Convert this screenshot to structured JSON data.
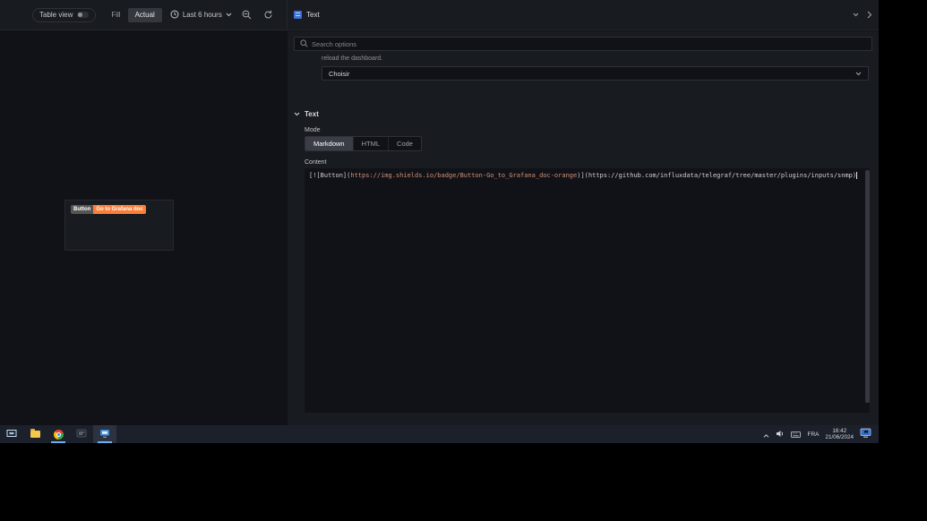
{
  "topbar": {
    "table_view_label": "Table view",
    "fill_label": "Fill",
    "actual_label": "Actual",
    "time_range_label": "Last 6 hours",
    "panel_type_label": "Text"
  },
  "preview": {
    "badge_left": "Button",
    "badge_right": "Go to Grafana doc"
  },
  "options": {
    "search_placeholder": "Search options",
    "description_text": "reload the dashboard.",
    "select_value": "Choisir",
    "section_title": "Text",
    "mode_label": "Mode",
    "mode_options": [
      "Markdown",
      "HTML",
      "Code"
    ],
    "mode_selected": "Markdown",
    "content_label": "Content",
    "code": {
      "seg1": "[![Button](",
      "url1": "https://img.shields.io/badge/Button-Go_to_Grafana_doc-orange",
      "seg2": ")](",
      "url2": "https://github.com/influxdata/telegraf/tree/master/plugins/inputs/snmp",
      "seg3": ")"
    }
  },
  "taskbar": {
    "language": "FRA",
    "time": "16:42",
    "date": "21/06/2024"
  },
  "colors": {
    "badge_orange": "#fe7d37",
    "badge_gray": "#555555",
    "code_url_orange": "#ce9178",
    "accent_blue": "#3d71d9"
  }
}
